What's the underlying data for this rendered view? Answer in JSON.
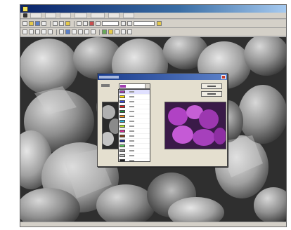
{
  "window": {
    "menu_items": [
      "file",
      "edit",
      "view",
      "image",
      "analysis",
      "window",
      "help"
    ],
    "toolbar1": [
      "new-icon",
      "open-icon",
      "save-icon",
      "print-icon",
      "cut-icon",
      "copy-icon",
      "paste-icon",
      "undo-icon",
      "redo-icon",
      "zoom-in-icon",
      "zoom-out-icon",
      "select-icon",
      "measure-icon",
      "color-icon"
    ],
    "toolbar2": [
      "pointer-icon",
      "line-icon",
      "rect-icon",
      "ellipse-icon",
      "polygon-icon",
      "text-icon",
      "fill-icon",
      "brush-icon",
      "eraser-icon",
      "histogram-icon",
      "threshold-icon",
      "filter-icon",
      "overlay-icon",
      "grid-icon"
    ]
  },
  "dialog": {
    "selected_color": "#a13fb0",
    "colors": [
      {
        "hex": "#a13fb0",
        "selected": true
      },
      {
        "hex": "#ffd800",
        "selected": false
      },
      {
        "hex": "#3b4bd8",
        "selected": false
      },
      {
        "hex": "#e22222",
        "selected": false
      },
      {
        "hex": "#1e8a3a",
        "selected": false
      },
      {
        "hex": "#f08a1c",
        "selected": false
      },
      {
        "hex": "#2bb4d6",
        "selected": false
      },
      {
        "hex": "#b3e02a",
        "selected": false
      },
      {
        "hex": "#d52b91",
        "selected": false
      },
      {
        "hex": "#7b3c14",
        "selected": false
      },
      {
        "hex": "#1b2a8a",
        "selected": false
      },
      {
        "hex": "#5cc15c",
        "selected": false
      },
      {
        "hex": "#8a8a8a",
        "selected": false
      },
      {
        "hex": "#c8c8c8",
        "selected": false
      },
      {
        "hex": "#202020",
        "selected": false
      },
      {
        "hex": "#ffffff",
        "selected": false
      }
    ]
  }
}
